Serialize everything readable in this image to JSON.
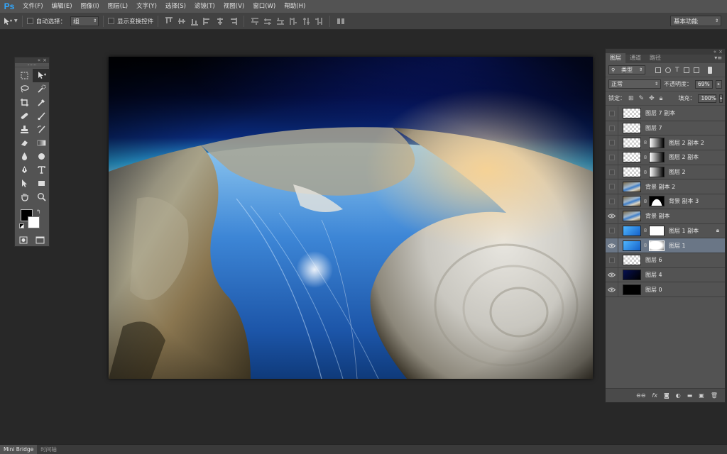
{
  "app": {
    "logo": "Ps"
  },
  "menu": [
    "文件(F)",
    "编辑(E)",
    "图像(I)",
    "图层(L)",
    "文字(Y)",
    "选择(S)",
    "滤镜(T)",
    "视图(V)",
    "窗口(W)",
    "帮助(H)"
  ],
  "options": {
    "tool_icon": "move-tool-icon",
    "auto_select_label": "自动选择：",
    "auto_select_value": "组",
    "show_transform_label": "显示变换控件",
    "workspace": "基本功能"
  },
  "tools_panel": {
    "collapse_glyph": "«",
    "close_glyph": "×",
    "tools": [
      "rect-marquee",
      "move",
      "lasso",
      "quick-select",
      "crop",
      "eyedropper",
      "spot-heal",
      "brush",
      "clone-stamp",
      "history-brush",
      "eraser",
      "gradient",
      "blur",
      "dodge",
      "pen",
      "type",
      "path-select",
      "rectangle",
      "hand",
      "zoom"
    ]
  },
  "layers_panel": {
    "tabs": [
      "图层",
      "通道",
      "路径"
    ],
    "filter_label": "类型",
    "blend_mode": "正常",
    "opacity_label": "不透明度：",
    "opacity_value": "69%",
    "lock_label": "锁定：",
    "fill_label": "填充：",
    "fill_value": "100%",
    "layers": [
      {
        "name": "图层 7 副本",
        "visible": false,
        "thumb": "checker"
      },
      {
        "name": "图层 7",
        "visible": false,
        "thumb": "checker"
      },
      {
        "name": "图层 2 副本 2",
        "visible": false,
        "thumb": "checker",
        "mask": "gradmask"
      },
      {
        "name": "图层 2 副本",
        "visible": false,
        "thumb": "checker",
        "mask": "gradmask"
      },
      {
        "name": "图层 2",
        "visible": false,
        "thumb": "checker",
        "mask": "gradmask"
      },
      {
        "name": "背景 副本 2",
        "visible": false,
        "thumb": "earth"
      },
      {
        "name": "背景 副本 3",
        "visible": false,
        "thumb": "earth",
        "mask": "blackmask"
      },
      {
        "name": "背景 副本",
        "visible": true,
        "thumb": "earth"
      },
      {
        "name": "图层 1 副本",
        "visible": false,
        "thumb": "blue",
        "mask": "whitemask",
        "locked": true
      },
      {
        "name": "图层 1",
        "visible": true,
        "thumb": "blue",
        "mask": "softmask",
        "selected": true
      },
      {
        "name": "图层 6",
        "visible": false,
        "thumb": "checker"
      },
      {
        "name": "图层 4",
        "visible": true,
        "thumb": "navy"
      },
      {
        "name": "图层 0",
        "visible": true,
        "thumb": "black"
      }
    ],
    "footer_icons": [
      "link-icon",
      "fx-icon",
      "mask-icon",
      "adjustment-icon",
      "folder-icon",
      "new-layer-icon",
      "trash-icon"
    ],
    "footer_fx": "fx"
  },
  "bottom_tabs": [
    "Mini Bridge",
    "时间轴"
  ]
}
